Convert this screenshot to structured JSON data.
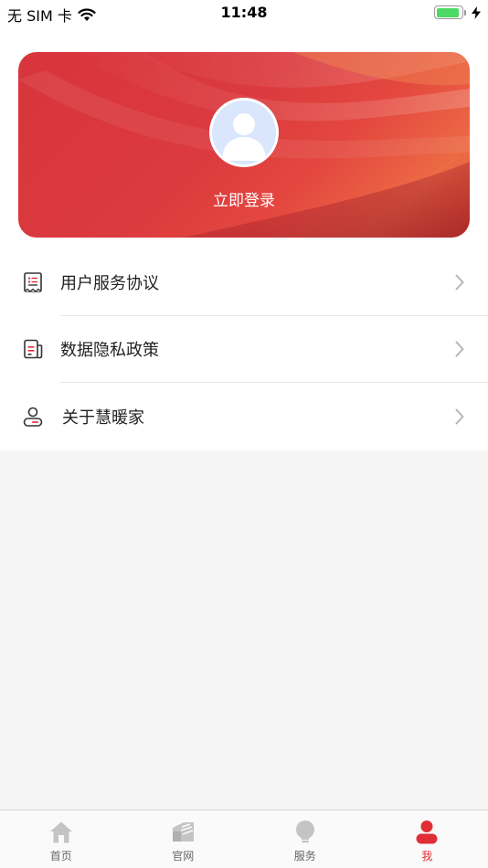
{
  "status_bar": {
    "carrier": "无 SIM 卡",
    "time": "11:48",
    "battery_level": 0.9
  },
  "profile": {
    "login_label": "立即登录"
  },
  "menu": {
    "items": [
      {
        "label": "用户服务协议",
        "icon": "agreement-icon"
      },
      {
        "label": "数据隐私政策",
        "icon": "privacy-policy-icon"
      },
      {
        "label": "关于慧暖家",
        "icon": "about-icon"
      }
    ]
  },
  "tab_bar": {
    "tabs": [
      {
        "label": "首页",
        "icon": "home-icon",
        "active": false
      },
      {
        "label": "官网",
        "icon": "website-icon",
        "active": false
      },
      {
        "label": "服务",
        "icon": "lightbulb-icon",
        "active": false
      },
      {
        "label": "我",
        "icon": "profile-icon",
        "active": true
      }
    ]
  },
  "colors": {
    "accent": "#e02e36",
    "card_start": "#d8353c",
    "card_end": "#ec6a45",
    "battery": "#4cd964",
    "inactive_icon": "#c4c4c4"
  }
}
